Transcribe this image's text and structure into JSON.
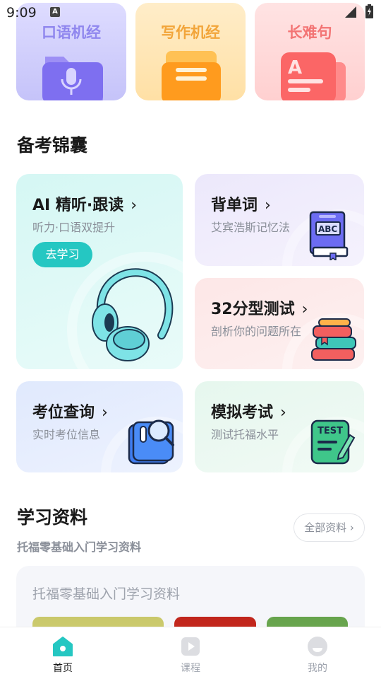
{
  "status": {
    "time": "9:09",
    "indicator": "A"
  },
  "top_cards": [
    {
      "label": "口语机经",
      "icon": "microphone-folder-icon"
    },
    {
      "label": "写作机经",
      "icon": "document-folder-icon"
    },
    {
      "label": "长难句",
      "icon": "letter-a-document-icon"
    }
  ],
  "prep_section": {
    "title": "备考锦囊"
  },
  "features": {
    "ai": {
      "title": "AI 精听·跟读",
      "subtitle": "听力·口语双提升",
      "button": "去学习",
      "icon": "headphones-icon"
    },
    "words": {
      "title": "背单词",
      "subtitle": "艾宾浩斯记忆法",
      "icon": "abc-book-icon"
    },
    "test32": {
      "title": "32分型测试",
      "subtitle": "剖析你的问题所在",
      "icon": "stacked-books-icon"
    },
    "seat": {
      "title": "考位查询",
      "subtitle": "实时考位信息",
      "icon": "search-document-icon"
    },
    "mock": {
      "title": "模拟考试",
      "subtitle": "测试托福水平",
      "icon": "test-paper-icon"
    },
    "chevron": "›"
  },
  "materials": {
    "title": "学习资料",
    "subtitle": "托福零基础入门学习资料",
    "all_button": "全部资料 ›",
    "box_title": "托福零基础入门学习资料"
  },
  "tabbar": {
    "home": "首页",
    "course": "课程",
    "me": "我的"
  },
  "colors": {
    "accent": "#25c7c2",
    "text_primary": "#1a1a1a",
    "text_secondary": "#8a8f99"
  }
}
